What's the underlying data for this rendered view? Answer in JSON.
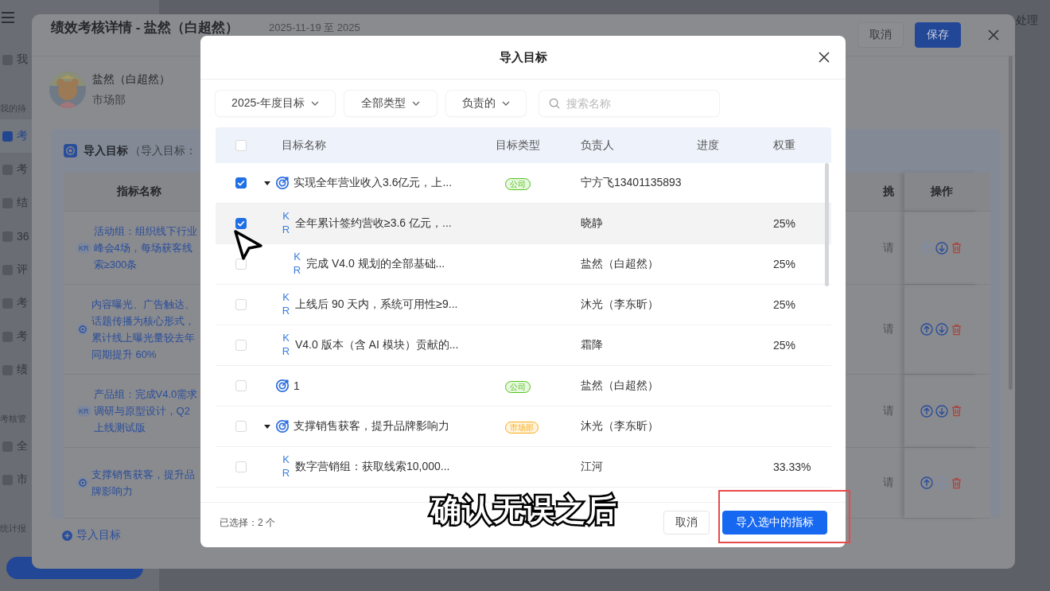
{
  "app": {
    "sidebar": {
      "items": [
        {
          "kind": "item",
          "label": "我",
          "selected": false
        },
        {
          "kind": "section",
          "label": "我的待"
        },
        {
          "kind": "item",
          "label": "考",
          "selected": true
        },
        {
          "kind": "item",
          "label": "考",
          "selected": false
        },
        {
          "kind": "item",
          "label": "结",
          "selected": false
        },
        {
          "kind": "item",
          "label": "36",
          "selected": false
        },
        {
          "kind": "item",
          "label": "评",
          "selected": false
        },
        {
          "kind": "item",
          "label": "考",
          "selected": false
        },
        {
          "kind": "item",
          "label": "考",
          "selected": false
        },
        {
          "kind": "item",
          "label": "绩",
          "selected": false
        },
        {
          "kind": "section",
          "label": "考核管"
        },
        {
          "kind": "item",
          "label": "全",
          "selected": false
        },
        {
          "kind": "item",
          "label": "市",
          "selected": false
        },
        {
          "kind": "section",
          "label": "统计报"
        }
      ]
    },
    "top_right_label": "处理"
  },
  "drawer": {
    "title": "绩效考核详情 - 盐然（白超然）",
    "period": "2025-11-19 至 2025",
    "buttons": {
      "cancel": "取消",
      "save": "保存"
    },
    "profile": {
      "name": "盐然（白超然）",
      "department": "市场部"
    },
    "panel": {
      "title": "导入目标",
      "subtitle": "（导入目标：",
      "columns": [
        "指标名称",
        "挑",
        "操作"
      ],
      "rows": [
        {
          "kind": "kr",
          "badge": "KR",
          "name": "活动组：组织线下行业峰会4场，每场获客线索≥300条",
          "placeholder": "请",
          "up_disabled": true,
          "down_disabled": false
        },
        {
          "kind": "goal",
          "name": "内容曝光、广告触达、话题传播为核心形式，累计线上曝光量较去年同期提升 60%",
          "placeholder": "请",
          "up_disabled": false,
          "down_disabled": false
        },
        {
          "kind": "kr",
          "badge": "KR",
          "name": "产品组：完成V4.0需求调研与原型设计，Q2上线测试版",
          "placeholder": "请",
          "up_disabled": false,
          "down_disabled": false
        },
        {
          "kind": "goal",
          "name": "支撑销售获客，提升品牌影响力",
          "placeholder": "请",
          "up_disabled": false,
          "down_disabled": true
        }
      ]
    },
    "add_link": "导入目标"
  },
  "dialog": {
    "title": "导入目标",
    "filters": [
      {
        "kind": "select",
        "label": "2025-年度目标"
      },
      {
        "kind": "select",
        "label": "全部类型"
      },
      {
        "kind": "select",
        "label": "负责的"
      },
      {
        "kind": "search",
        "placeholder": "搜索名称"
      }
    ],
    "table": {
      "select_all": {
        "checked": false
      },
      "columns": [
        "目标名称",
        "目标类型",
        "负责人",
        "进度",
        "权重"
      ],
      "rows": [
        {
          "kind": "goal",
          "checked": true,
          "hovered": false,
          "expanded": true,
          "name": "实现全年营业收入3.6亿元，上...",
          "tag": {
            "label": "公司",
            "color": "#52c41a"
          },
          "owner": "宁方飞13401135893",
          "children": [
            {
              "kind": "kr",
              "badge": "KR",
              "checked": true,
              "hovered": true,
              "name": "全年累计签约营收≥3.6 亿元，...",
              "owner": "晓静",
              "weight": "25%",
              "children": [
                {
                  "kind": "kr",
                  "badge": "KR",
                  "checked": false,
                  "hovered": false,
                  "name": "完成 V4.0 规划的全部基础...",
                  "owner": "盐然（白超然）",
                  "weight": "25%"
                }
              ]
            },
            {
              "kind": "kr",
              "badge": "KR",
              "checked": false,
              "hovered": false,
              "name": "上线后 90 天内，系统可用性≥9...",
              "owner": "沐光（李东昕）",
              "weight": "25%"
            },
            {
              "kind": "kr",
              "badge": "KR",
              "checked": false,
              "hovered": false,
              "name": "V4.0 版本（含 AI 模块）贡献的...",
              "owner": "霜降",
              "weight": "25%"
            }
          ]
        },
        {
          "kind": "goal",
          "checked": false,
          "hovered": false,
          "name": "1",
          "tag": {
            "label": "公司",
            "color": "#52c41a"
          },
          "owner": "盐然（白超然）"
        },
        {
          "kind": "goal",
          "checked": false,
          "hovered": false,
          "expanded": true,
          "name": "支撑销售获客，提升品牌影响力",
          "tag": {
            "label": "市场部",
            "color": "#faad14"
          },
          "owner": "沐光（李东昕）",
          "children": [
            {
              "kind": "kr",
              "badge": "KR",
              "checked": false,
              "hovered": false,
              "name": "数字营销组：获取线索10,000...",
              "owner": "江河",
              "weight": "33.33%"
            }
          ]
        }
      ]
    },
    "footer": {
      "selected_count": "已选择：2 个",
      "buttons": [
        {
          "kind": "secondary",
          "label": "取消",
          "highlighted": false
        },
        {
          "kind": "primary",
          "label": "导入选中的指标",
          "highlighted": true
        }
      ]
    }
  },
  "caption": "确认无误之后"
}
